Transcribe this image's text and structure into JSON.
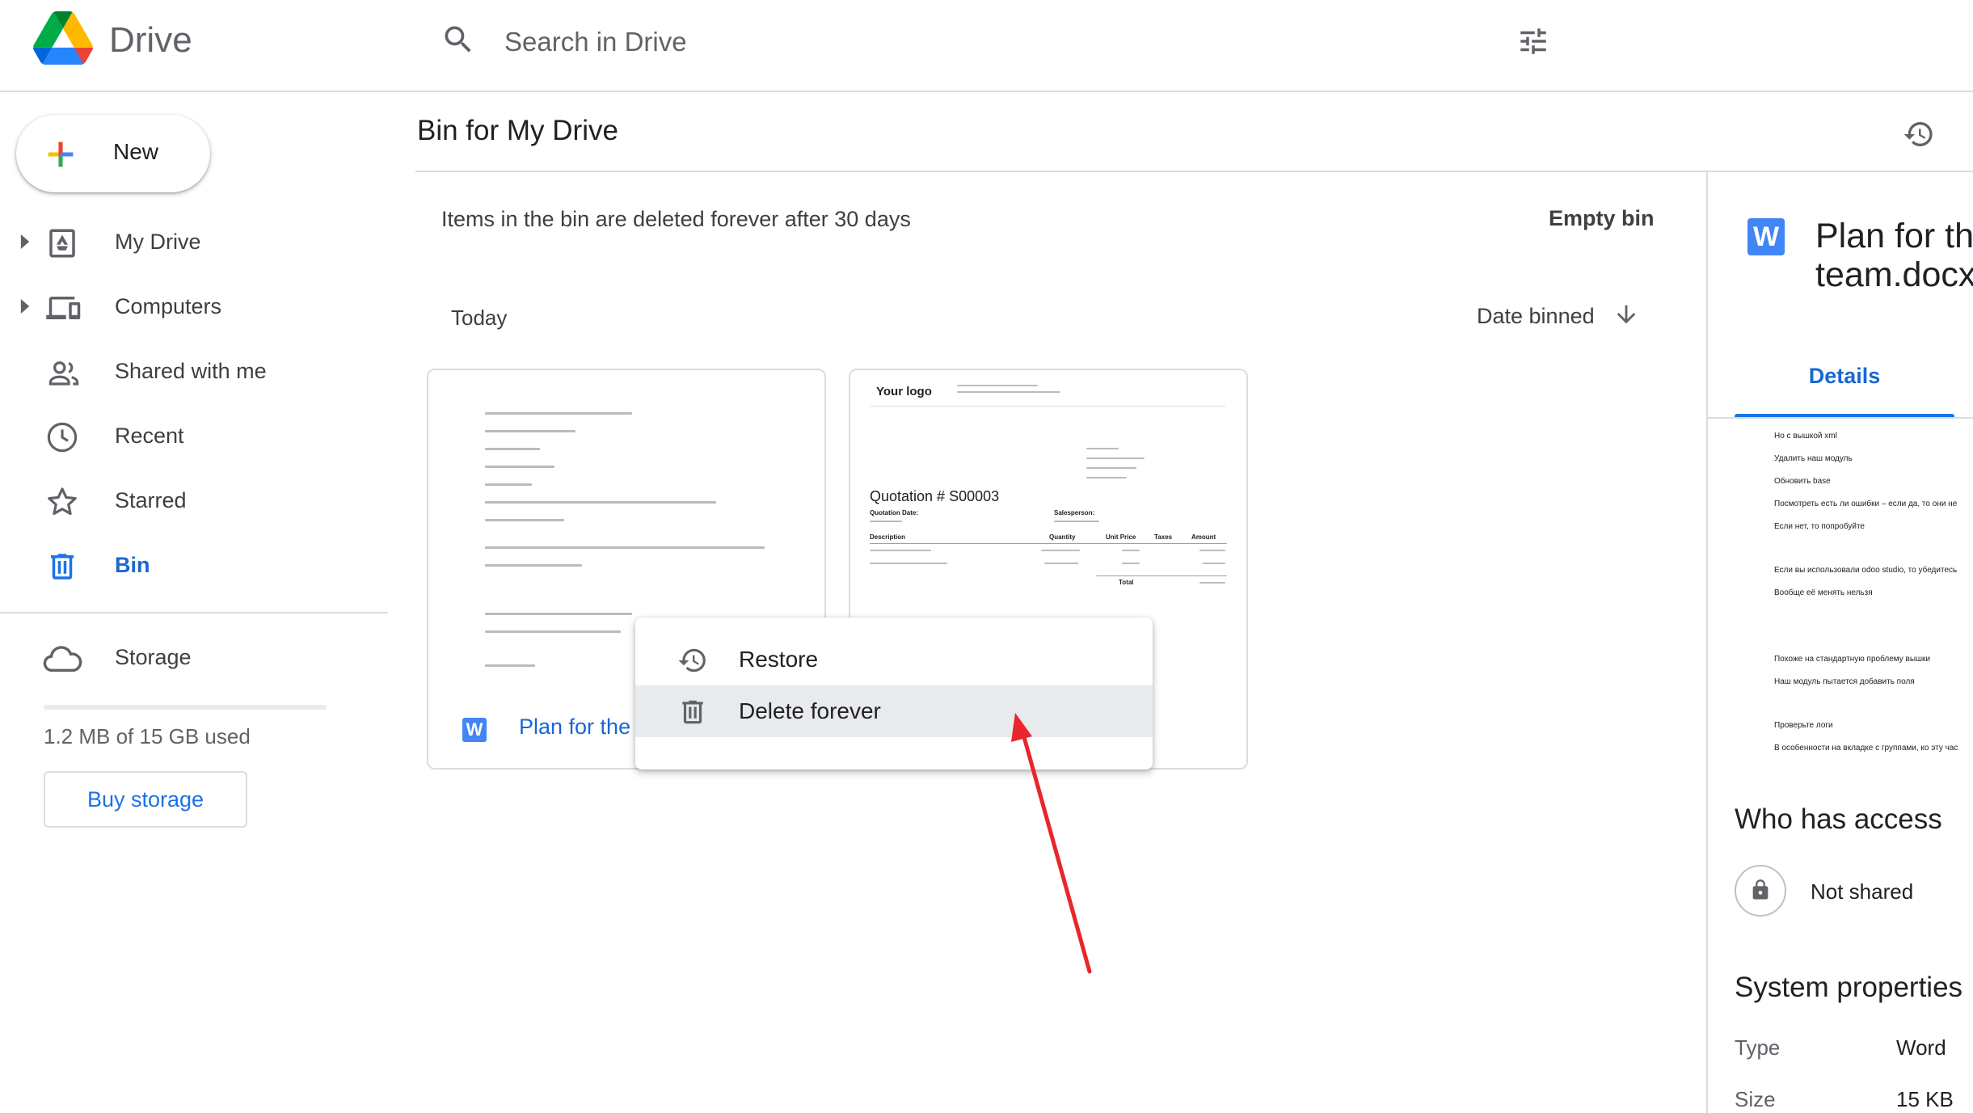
{
  "app": {
    "name": "Drive"
  },
  "search": {
    "placeholder": "Search in Drive"
  },
  "sidebar": {
    "new_label": "New",
    "items": [
      {
        "label": "My Drive",
        "icon": "my-drive-icon"
      },
      {
        "label": "Computers",
        "icon": "computers-icon"
      },
      {
        "label": "Shared with me",
        "icon": "people-icon"
      },
      {
        "label": "Recent",
        "icon": "clock-icon"
      },
      {
        "label": "Starred",
        "icon": "star-icon"
      },
      {
        "label": "Bin",
        "icon": "trash-icon",
        "active": true
      },
      {
        "label": "Storage",
        "icon": "cloud-icon"
      }
    ],
    "storage_used_fraction": 0.0001,
    "storage_text": "1.2 MB of 15 GB used",
    "buy_storage_label": "Buy storage"
  },
  "main": {
    "title": "Bin for My Drive",
    "notice": "Items in the bin are deleted forever after 30 days",
    "empty_bin_label": "Empty bin",
    "group_label": "Today",
    "sort_label": "Date binned",
    "cards": [
      {
        "name": "Plan for the",
        "icon_letter": "W"
      },
      {
        "logo_text": "Your logo",
        "quotation_title": "Quotation # S00003",
        "quotation_date_label": "Quotation Date:",
        "salesperson_label": "Salesperson:",
        "columns": [
          "Description",
          "Quantity",
          "Unit Price",
          "Taxes",
          "Amount"
        ],
        "total_label": "Total"
      }
    ]
  },
  "context_menu": {
    "items": [
      {
        "label": "Restore",
        "icon": "restore-icon"
      },
      {
        "label": "Delete forever",
        "icon": "trash-icon",
        "hovered": true
      }
    ]
  },
  "details": {
    "file_icon_letter": "W",
    "title": "Plan for the team.docx",
    "tab_label": "Details",
    "preview_lines": [
      "Но с вышкой xml",
      "Удалить наш модуль",
      "Обновить base",
      "Посмотреть есть ли ошибки – если да, то они не",
      "Если нет, то попробуйте",
      "Если вы использовали odoo studio, то убедитесь",
      "Вообще её менять нельзя",
      "Похоже на стандартную проблему вышки",
      "Наш модуль пытается добавить поля",
      "Проверьте логи",
      "В особенности на вкладке с группами, ко эту час"
    ],
    "who_has_access_label": "Who has access",
    "access_value": "Not shared",
    "system_properties_label": "System properties",
    "properties": [
      {
        "label": "Type",
        "value": "Word"
      },
      {
        "label": "Size",
        "value": "15 KB"
      }
    ]
  },
  "colors": {
    "accent": "#1a73e8",
    "active_text": "#1967d2",
    "divider": "#dadce0",
    "annotation_arrow": "#e8262b"
  }
}
